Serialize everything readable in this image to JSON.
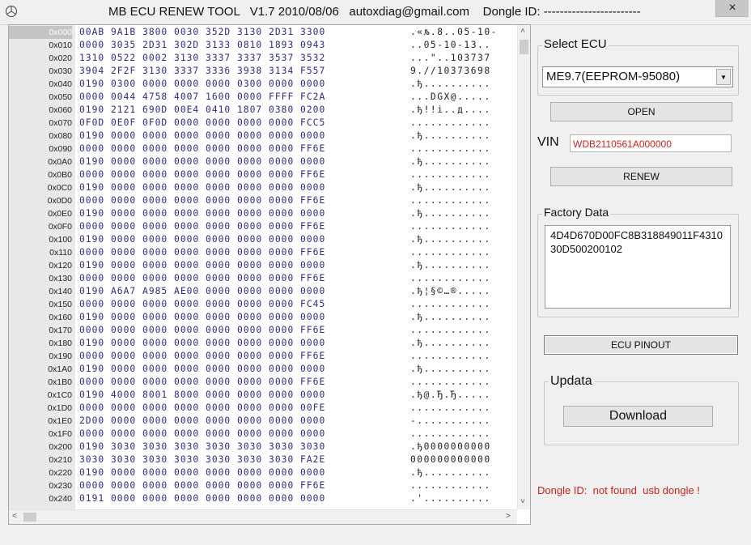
{
  "window": {
    "title": "MB ECU RENEW TOOL   V1.7 2010/08/06   autoxdiag@gmail.com    Dongle ID: ------------------------",
    "close_icon": "×"
  },
  "hex": {
    "rows": [
      {
        "addr": "0x000",
        "bytes": "00AB 9A1B 3800 0030 352D 3130 2D31 3300",
        "ascii": ".«љ.8..05-10-"
      },
      {
        "addr": "0x010",
        "bytes": "0000 3035 2D31 302D 3133 0810 1893 0943",
        "ascii": "..05-10-13.."
      },
      {
        "addr": "0x020",
        "bytes": "1310 0522 0002 3130 3337 3337 3537 3532",
        "ascii": "...\"..103737"
      },
      {
        "addr": "0x030",
        "bytes": "3904 2F2F 3130 3337 3336 3938 3134 F557",
        "ascii": "9.//10373698"
      },
      {
        "addr": "0x040",
        "bytes": "0190 0300 0000 0000 0000 0300 0000 0000",
        "ascii": ".ђ.........."
      },
      {
        "addr": "0x050",
        "bytes": "0000 0044 4758 4007 1600 0000 FFFF FC2A",
        "ascii": "...DGX@....."
      },
      {
        "addr": "0x060",
        "bytes": "0190 2121 690D 00E4 0410 1807 0380 0200",
        "ascii": ".ђ!!i..д...."
      },
      {
        "addr": "0x070",
        "bytes": "0F0D 0E0F 0F0D 0000 0000 0000 0000 FCC5",
        "ascii": "............"
      },
      {
        "addr": "0x080",
        "bytes": "0190 0000 0000 0000 0000 0000 0000 0000",
        "ascii": ".ђ.........."
      },
      {
        "addr": "0x090",
        "bytes": "0000 0000 0000 0000 0000 0000 0000 FF6E",
        "ascii": "............"
      },
      {
        "addr": "0x0A0",
        "bytes": "0190 0000 0000 0000 0000 0000 0000 0000",
        "ascii": ".ђ.........."
      },
      {
        "addr": "0x0B0",
        "bytes": "0000 0000 0000 0000 0000 0000 0000 FF6E",
        "ascii": "............"
      },
      {
        "addr": "0x0C0",
        "bytes": "0190 0000 0000 0000 0000 0000 0000 0000",
        "ascii": ".ђ.........."
      },
      {
        "addr": "0x0D0",
        "bytes": "0000 0000 0000 0000 0000 0000 0000 FF6E",
        "ascii": "............"
      },
      {
        "addr": "0x0E0",
        "bytes": "0190 0000 0000 0000 0000 0000 0000 0000",
        "ascii": ".ђ.........."
      },
      {
        "addr": "0x0F0",
        "bytes": "0000 0000 0000 0000 0000 0000 0000 FF6E",
        "ascii": "............"
      },
      {
        "addr": "0x100",
        "bytes": "0190 0000 0000 0000 0000 0000 0000 0000",
        "ascii": ".ђ.........."
      },
      {
        "addr": "0x110",
        "bytes": "0000 0000 0000 0000 0000 0000 0000 FF6E",
        "ascii": "............"
      },
      {
        "addr": "0x120",
        "bytes": "0190 0000 0000 0000 0000 0000 0000 0000",
        "ascii": ".ђ.........."
      },
      {
        "addr": "0x130",
        "bytes": "0000 0000 0000 0000 0000 0000 0000 FF6E",
        "ascii": "............"
      },
      {
        "addr": "0x140",
        "bytes": "0190 A6A7 A985 AE00 0000 0000 0000 0000",
        "ascii": ".ђ¦§©…®....."
      },
      {
        "addr": "0x150",
        "bytes": "0000 0000 0000 0000 0000 0000 0000 FC45",
        "ascii": "............"
      },
      {
        "addr": "0x160",
        "bytes": "0190 0000 0000 0000 0000 0000 0000 0000",
        "ascii": ".ђ.........."
      },
      {
        "addr": "0x170",
        "bytes": "0000 0000 0000 0000 0000 0000 0000 FF6E",
        "ascii": "............"
      },
      {
        "addr": "0x180",
        "bytes": "0190 0000 0000 0000 0000 0000 0000 0000",
        "ascii": ".ђ.........."
      },
      {
        "addr": "0x190",
        "bytes": "0000 0000 0000 0000 0000 0000 0000 FF6E",
        "ascii": "............"
      },
      {
        "addr": "0x1A0",
        "bytes": "0190 0000 0000 0000 0000 0000 0000 0000",
        "ascii": ".ђ.........."
      },
      {
        "addr": "0x1B0",
        "bytes": "0000 0000 0000 0000 0000 0000 0000 FF6E",
        "ascii": "............"
      },
      {
        "addr": "0x1C0",
        "bytes": "0190 4000 8001 8000 0000 0000 0000 0000",
        "ascii": ".ђ@.Ђ.Ђ....."
      },
      {
        "addr": "0x1D0",
        "bytes": "0000 0000 0000 0000 0000 0000 0000 00FE",
        "ascii": "............"
      },
      {
        "addr": "0x1E0",
        "bytes": "2D00 0000 0000 0000 0000 0000 0000 0000",
        "ascii": "-..........."
      },
      {
        "addr": "0x1F0",
        "bytes": "0000 0000 0000 0000 0000 0000 0000 0000",
        "ascii": "............"
      },
      {
        "addr": "0x200",
        "bytes": "0190 3030 3030 3030 3030 3030 3030 3030",
        "ascii": ".ђ0000000000"
      },
      {
        "addr": "0x210",
        "bytes": "3030 3030 3030 3030 3030 3030 3030 FA2E",
        "ascii": "000000000000"
      },
      {
        "addr": "0x220",
        "bytes": "0190 0000 0000 0000 0000 0000 0000 0000",
        "ascii": ".ђ.........."
      },
      {
        "addr": "0x230",
        "bytes": "0000 0000 0000 0000 0000 0000 0000 FF6E",
        "ascii": "............"
      },
      {
        "addr": "0x240",
        "bytes": "0191 0000 0000 0000 0000 0000 0000 0000",
        "ascii": ".'.........."
      }
    ],
    "scroll_up_icon": "˄",
    "scroll_down_icon": "˅",
    "scroll_left_icon": "<",
    "scroll_right_icon": ">"
  },
  "select_ecu": {
    "label": "Select ECU",
    "value": "ME9.7(EEPROM-95080)",
    "dropdown_icon": "▼"
  },
  "buttons": {
    "open": "OPEN",
    "renew": "RENEW",
    "ecu_pinout": "ECU PINOUT",
    "download": "Download"
  },
  "vin": {
    "label": "VIN",
    "value": "WDB2110561A000000"
  },
  "factory_data": {
    "label": "Factory Data",
    "value": "4D4D670D00FC8B318849011F431030D500200102"
  },
  "updata": {
    "label": "Updata"
  },
  "status": {
    "dongle": "Dongle ID:  not found  usb dongle !"
  },
  "colors": {
    "hex_bytes": "#2a2a8a",
    "error_red": "#d02020",
    "window_bg": "#f0f0f0"
  }
}
